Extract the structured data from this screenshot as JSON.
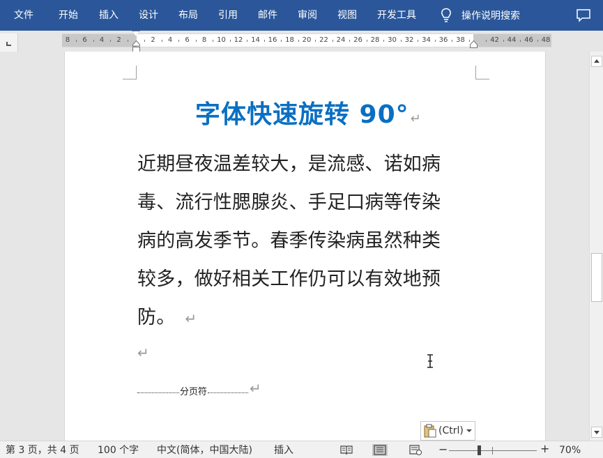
{
  "ribbon": {
    "tabs": [
      "文件",
      "开始",
      "插入",
      "设计",
      "布局",
      "引用",
      "邮件",
      "审阅",
      "视图",
      "开发工具"
    ],
    "tell_me": "操作说明搜索",
    "bg_color": "#2b579a"
  },
  "ruler": {
    "left_numbers": [
      "8",
      "6",
      "4",
      "2"
    ],
    "right_numbers": [
      "2",
      "4",
      "6",
      "8",
      "10",
      "12",
      "14",
      "16",
      "18",
      "20",
      "22",
      "24",
      "26",
      "28",
      "30",
      "32",
      "34",
      "36",
      "38"
    ],
    "margin_numbers": [
      "42",
      "44",
      "46",
      "48"
    ]
  },
  "document": {
    "title": "字体快速旋转 90°",
    "title_color": "#0a6fc2",
    "paragraph_lines": [
      "近期昼夜温差较大，是流感、诺如病",
      "毒、流行性腮腺炎、手足口病等传染",
      "病的高发季节。春季传染病虽然种类",
      "较多，做好相关工作仍可以有效地预",
      "防。"
    ],
    "paragraph_mark": "↵",
    "page_break_label": "分页符",
    "paste_options_label": "(Ctrl)"
  },
  "status": {
    "page": "第 3 页，共 4 页",
    "words": "100 个字",
    "language": "中文(简体，中国大陆)",
    "mode": "插入",
    "zoom_minus": "−",
    "zoom_plus": "+",
    "zoom": "70%"
  },
  "icons": {
    "tell_me": "lightbulb-icon",
    "comments": "comment-icon",
    "paste_options": "clipboard-icon",
    "cursor": "text-cursor-icon",
    "read_mode": "read-mode-icon",
    "print_layout": "print-layout-icon",
    "web_layout": "web-layout-icon"
  }
}
